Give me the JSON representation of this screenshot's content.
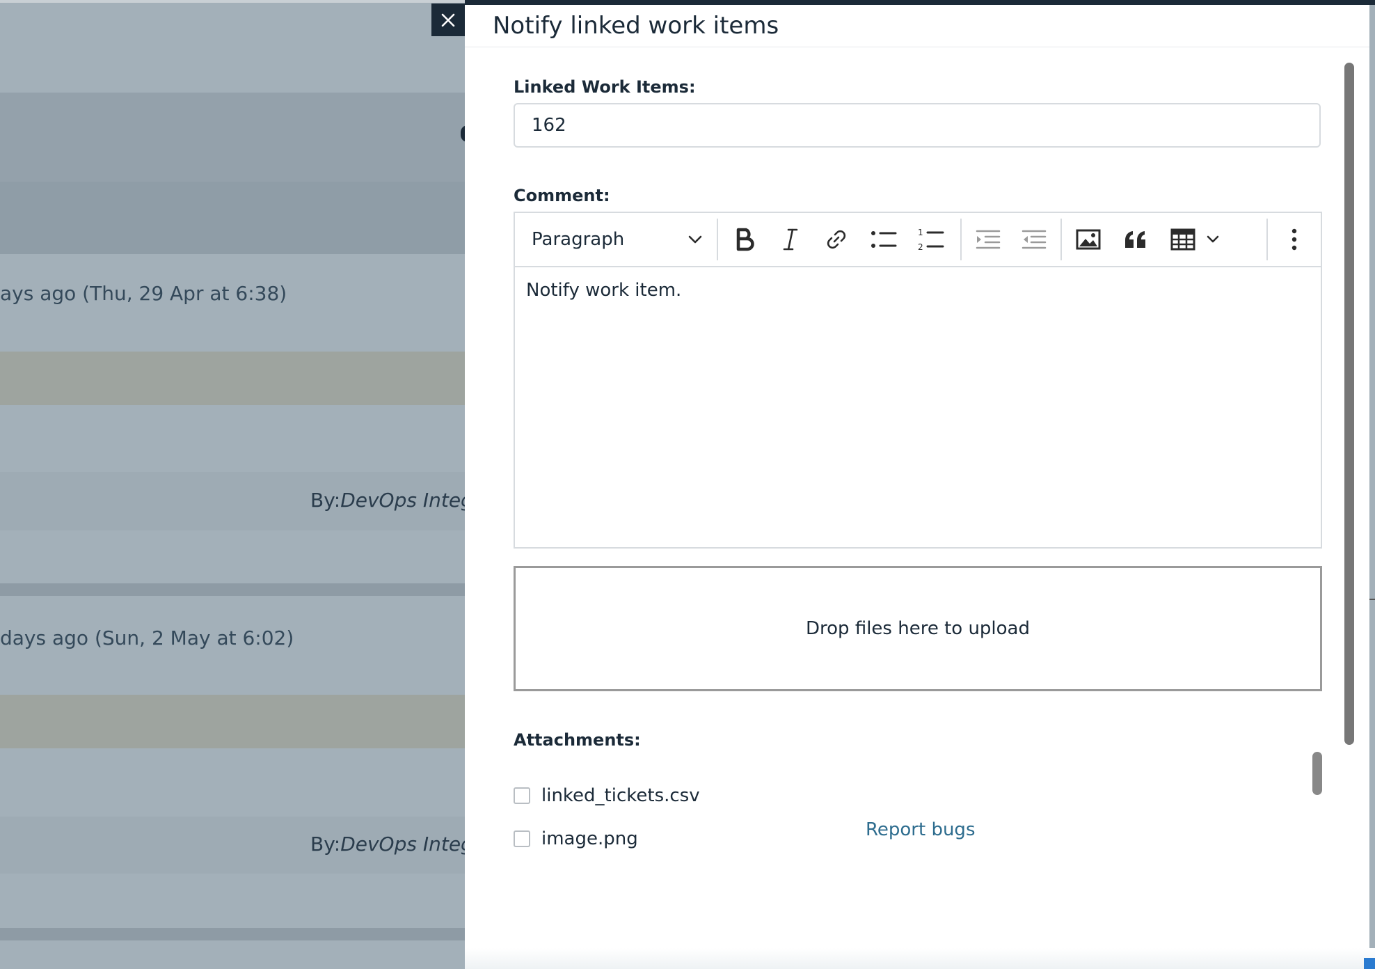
{
  "background": {
    "rows": [
      {
        "text": "ays ago (Thu, 29 Apr at 6:38)"
      },
      {
        "by_prefix": "By:",
        "by_name": "DevOps Integr"
      },
      {
        "text": "days ago (Sun, 2 May at 6:02)"
      },
      {
        "by_prefix": "By:",
        "by_name": "DevOps Integr"
      }
    ]
  },
  "dialog": {
    "close_icon": "close-icon",
    "title": "Notify linked work items",
    "linked_label": "Linked Work Items:",
    "linked_value": "162",
    "comment_label": "Comment:",
    "toolbar": {
      "paragraph_label": "Paragraph",
      "buttons": [
        "bold-icon",
        "italic-icon",
        "link-icon",
        "bulleted-list-icon",
        "numbered-list-icon",
        "outdent-icon",
        "indent-icon",
        "image-icon",
        "blockquote-icon",
        "table-icon",
        "more-icon"
      ]
    },
    "comment_text": "Notify work item.",
    "dropzone_text": "Drop files here to upload",
    "attachments_label": "Attachments:",
    "attachments": [
      {
        "name": "linked_tickets.csv",
        "checked": false
      },
      {
        "name": "image.png",
        "checked": false
      }
    ],
    "report_link": "Report bugs"
  }
}
